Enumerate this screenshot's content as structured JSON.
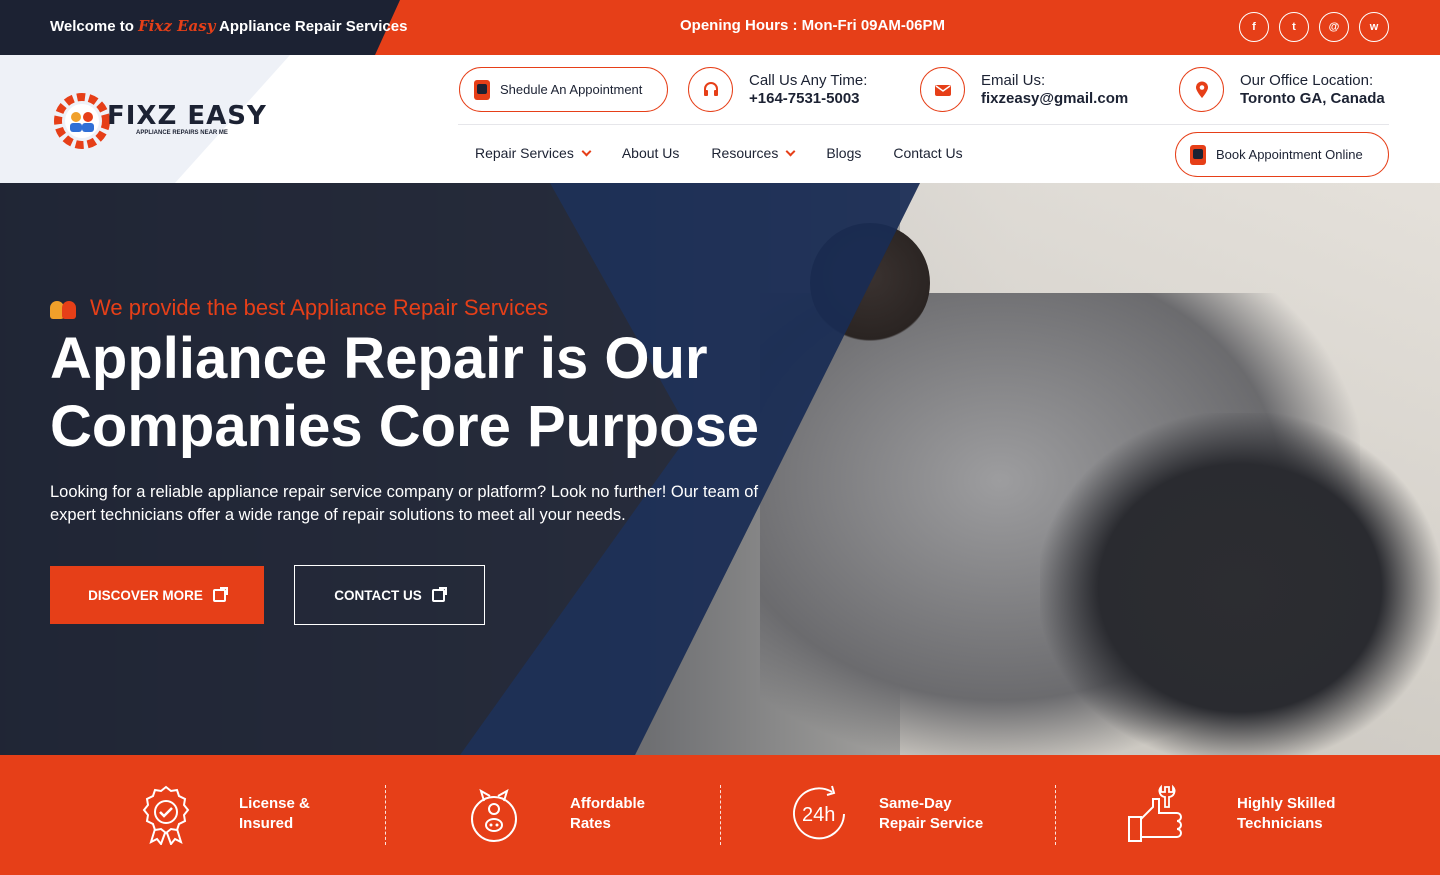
{
  "topbar": {
    "welcome_prefix": "Welcome to ",
    "welcome_brand": "Fixz Easy",
    "welcome_suffix": " Appliance Repair Services",
    "hours": "Opening Hours : Mon-Fri 09AM-06PM",
    "socials": [
      "f",
      "t",
      "@",
      "w"
    ]
  },
  "header": {
    "logo_name": "FIXZ EASY",
    "logo_tagline": "APPLIANCE REPAIRS NEAR ME",
    "schedule_button": "Shedule An Appointment",
    "call_label": "Call Us Any Time:",
    "call_value": "+164-7531-5003",
    "email_label": "Email Us:",
    "email_value": "fixzeasy@gmail.com",
    "office_label": "Our Office Location:",
    "office_value": "Toronto GA, Canada",
    "book_button": "Book Appointment Online"
  },
  "nav": {
    "items": [
      {
        "label": "Repair Services",
        "dropdown": true
      },
      {
        "label": "About Us",
        "dropdown": false
      },
      {
        "label": "Resources",
        "dropdown": true
      },
      {
        "label": "Blogs",
        "dropdown": false
      },
      {
        "label": "Contact Us",
        "dropdown": false
      }
    ]
  },
  "hero": {
    "eyebrow": "We provide the best Appliance Repair Services",
    "title": "Appliance Repair is Our Companies Core Purpose",
    "description": "Looking for a reliable appliance repair service company or platform? Look no further! Our team of expert technicians offer a wide range of repair solutions to meet all your needs.",
    "primary_button": "DISCOVER MORE",
    "secondary_button": "CONTACT US"
  },
  "features": [
    {
      "icon": "certificate-badge-icon",
      "label": "License &\nInsured"
    },
    {
      "icon": "piggy-bank-icon",
      "label": "Affordable\nRates"
    },
    {
      "icon": "24h-clock-icon",
      "label": "Same-Day\nRepair Service",
      "icon_text": "24h"
    },
    {
      "icon": "thumbs-up-wrench-icon",
      "label": "Highly Skilled\nTechnicians"
    }
  ],
  "colors": {
    "accent": "#e63f18",
    "dark": "#1c2233",
    "white": "#ffffff"
  }
}
